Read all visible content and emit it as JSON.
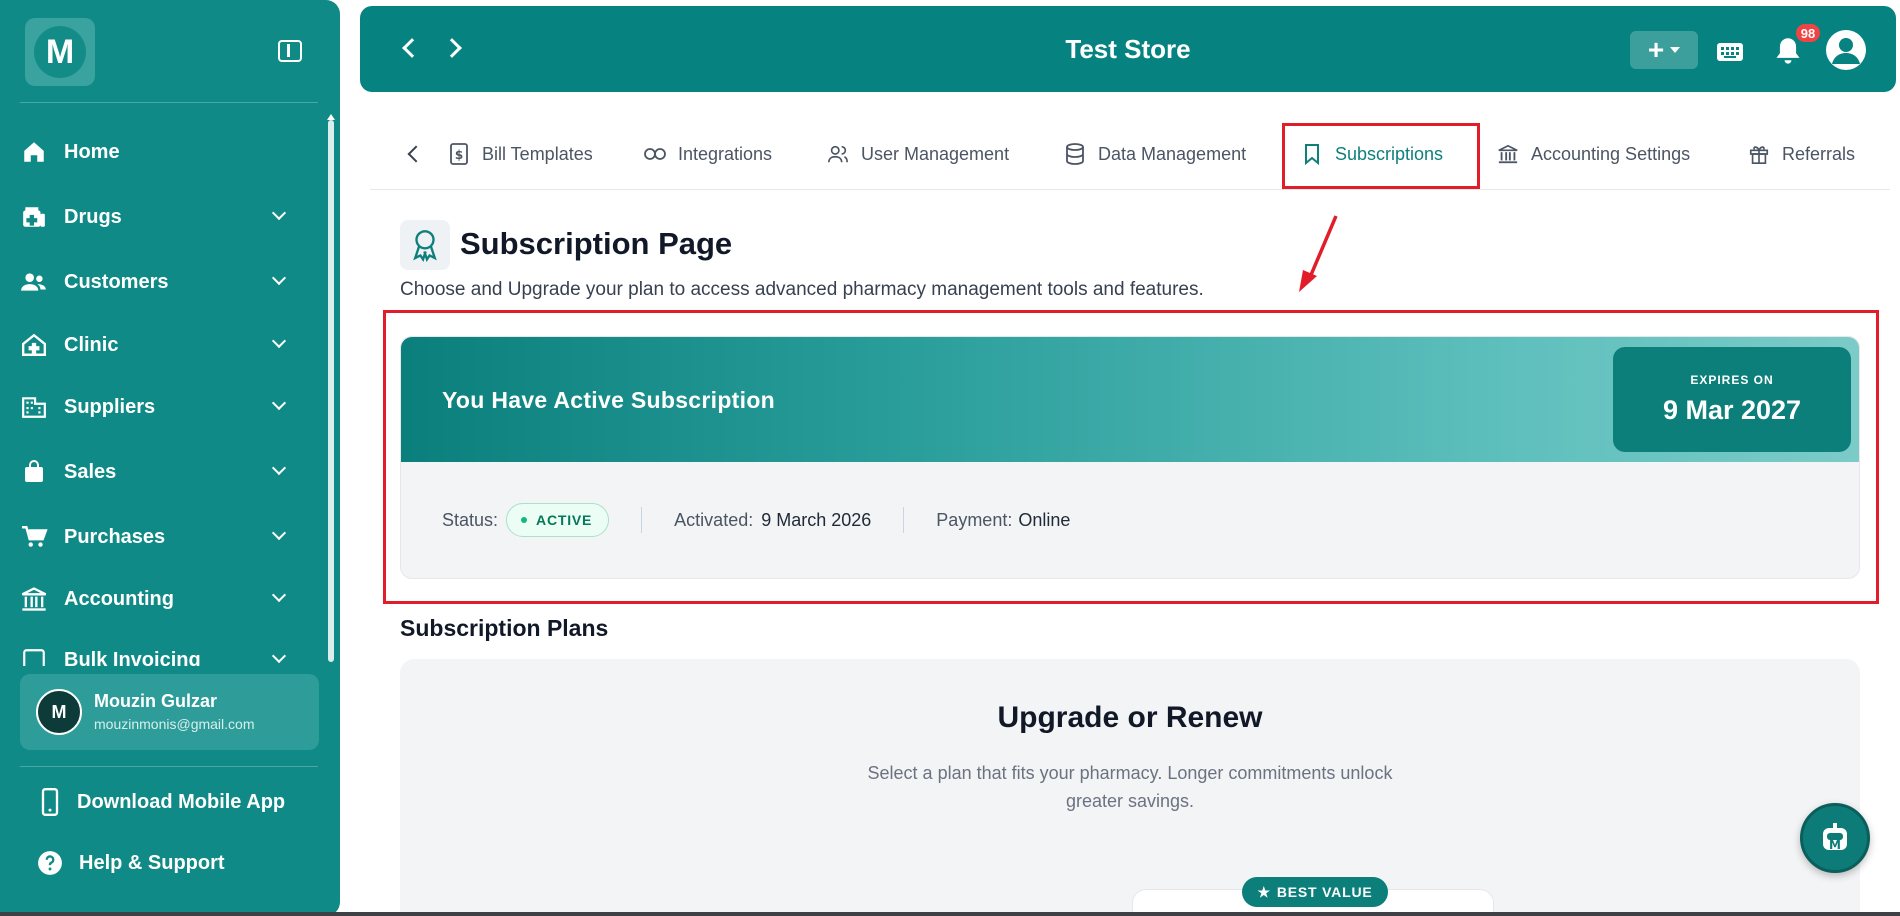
{
  "sidebar": {
    "logo_letter": "M",
    "nav": [
      {
        "label": "Home",
        "icon": "home-icon",
        "expandable": false
      },
      {
        "label": "Drugs",
        "icon": "medicine-icon",
        "expandable": true
      },
      {
        "label": "Customers",
        "icon": "users-icon",
        "expandable": true
      },
      {
        "label": "Clinic",
        "icon": "clinic-icon",
        "expandable": true
      },
      {
        "label": "Suppliers",
        "icon": "building-icon",
        "expandable": true
      },
      {
        "label": "Sales",
        "icon": "shopping-bag-icon",
        "expandable": true
      },
      {
        "label": "Purchases",
        "icon": "cart-icon",
        "expandable": true
      },
      {
        "label": "Accounting",
        "icon": "bank-icon",
        "expandable": true
      },
      {
        "label": "Bulk Invoicing",
        "icon": "invoice-icon",
        "expandable": true
      }
    ],
    "user": {
      "initial": "M",
      "name": "Mouzin Gulzar",
      "email": "mouzinmonis@gmail.com"
    },
    "download_label": "Download Mobile App",
    "help_label": "Help & Support"
  },
  "header": {
    "store_name": "Test Store",
    "notification_count": "98"
  },
  "tabs": [
    {
      "label": "Bill Templates",
      "icon": "dollar-file-icon"
    },
    {
      "label": "Integrations",
      "icon": "link-icon"
    },
    {
      "label": "User Management",
      "icon": "users-icon"
    },
    {
      "label": "Data Management",
      "icon": "database-icon"
    },
    {
      "label": "Subscriptions",
      "icon": "bookmark-icon",
      "active": true
    },
    {
      "label": "Accounting Settings",
      "icon": "bank-icon"
    },
    {
      "label": "Referrals",
      "icon": "gift-icon"
    }
  ],
  "page": {
    "title": "Subscription Page",
    "subtitle": "Choose and Upgrade your plan to access advanced pharmacy management tools and features."
  },
  "subscription": {
    "banner_title": "You Have Active Subscription",
    "expires_label": "EXPIRES ON",
    "expires_date": "9 Mar 2027",
    "status_label": "Status:",
    "status_value": "ACTIVE",
    "activated_label": "Activated:",
    "activated_value": "9 March 2026",
    "payment_label": "Payment:",
    "payment_value": "Online"
  },
  "plans": {
    "section_title": "Subscription Plans",
    "heading": "Upgrade or Renew",
    "description": "Select a plan that fits your pharmacy. Longer commitments unlock greater savings.",
    "badge": "BEST VALUE"
  },
  "colors": {
    "primary": "#068381",
    "sidebar": "#0f8a86",
    "highlight": "#e11d2a",
    "badge": "#ef4444"
  }
}
